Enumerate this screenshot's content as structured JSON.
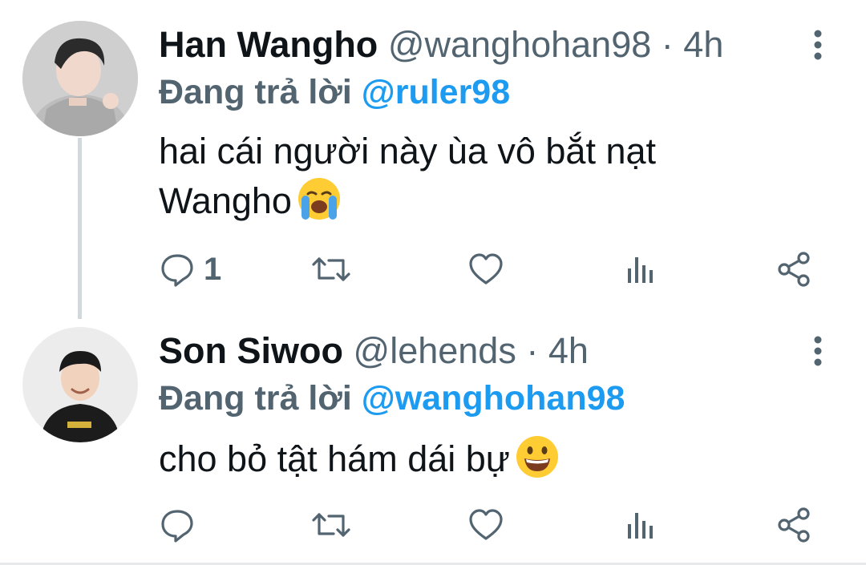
{
  "tweets": [
    {
      "display_name": "Han Wangho",
      "handle": "@wanghohan98",
      "separator": "·",
      "time": "4h",
      "reply_prefix": "Đang trả lời",
      "reply_to": "@ruler98",
      "text": "hai cái người này ùa vô bắt nạt Wangho",
      "emoji": "loudly-crying-face",
      "reply_count": "1",
      "avatar_icon": "avatar-han-wangho"
    },
    {
      "display_name": "Son Siwoo",
      "handle": "@lehends",
      "separator": "·",
      "time": "4h",
      "reply_prefix": "Đang trả lời",
      "reply_to": "@wanghohan98",
      "text": "cho bỏ tật hám dái bự",
      "emoji": "grinning-face",
      "reply_count": "",
      "avatar_icon": "avatar-son-siwoo"
    }
  ],
  "colors": {
    "link": "#1d9bf0",
    "secondary": "#536471",
    "text": "#0f1419",
    "thread_line": "#cfd9de"
  },
  "icons": [
    "reply-icon",
    "retweet-icon",
    "like-icon",
    "views-icon",
    "share-icon",
    "more-icon"
  ]
}
